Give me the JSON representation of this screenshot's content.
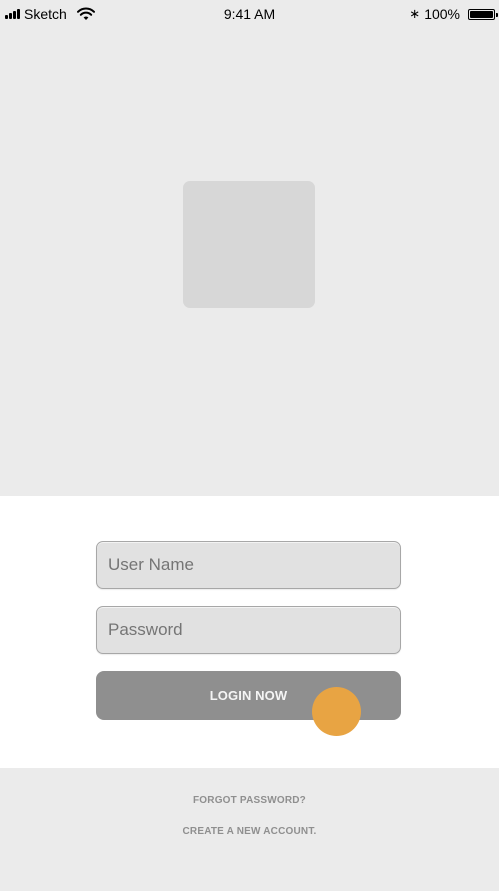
{
  "status_bar": {
    "carrier": "Sketch",
    "time": "9:41 AM",
    "battery": "100%",
    "bluetooth_symbol": "∗",
    "icons": {
      "signal": "signal-icon",
      "wifi": "wifi-icon",
      "bluetooth": "bluetooth-icon",
      "battery": "battery-icon"
    }
  },
  "login_form": {
    "username_placeholder": "User Name",
    "username_value": "",
    "password_placeholder": "Password",
    "password_value": "",
    "login_label": "LOGIN NOW"
  },
  "links": {
    "forgot_password": "FORGOT PASSWORD?",
    "create_account": "CREATE A NEW ACCOUNT."
  },
  "colors": {
    "top_background": "#ebebeb",
    "placeholder_block": "#d7d7d7",
    "input_background": "#e1e1e1",
    "button_background": "#8f8f8f",
    "touch_indicator": "#e8a443",
    "link_text": "#8f8f8f"
  }
}
